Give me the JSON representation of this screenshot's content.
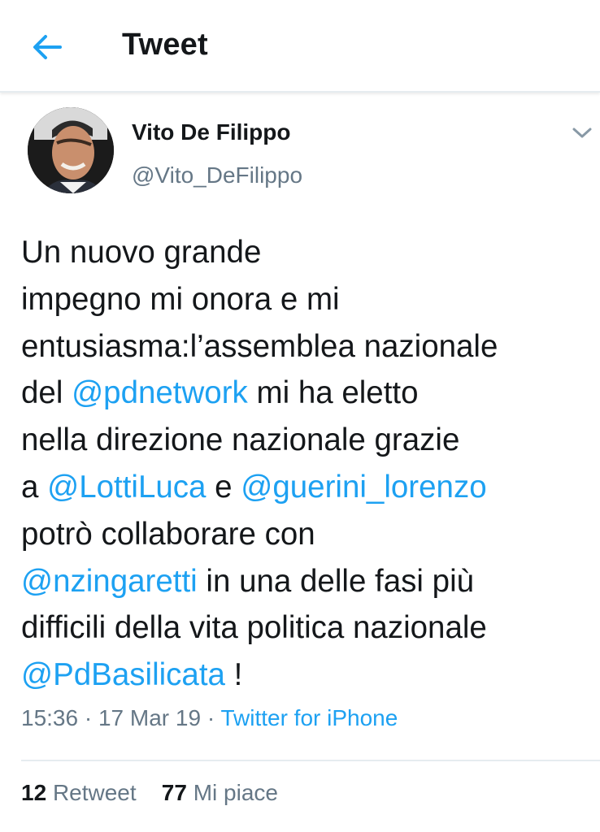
{
  "header": {
    "title": "Tweet"
  },
  "colors": {
    "accent": "#1da1f2",
    "secondary_text": "#657786",
    "primary_text": "#14171a",
    "divider": "#e6ecf0"
  },
  "icons": {
    "back": "arrow-left-icon",
    "menu": "chevron-down-icon"
  },
  "tweet": {
    "author_name": "Vito De Filippo",
    "author_handle": "@Vito_DeFilippo",
    "lines": [
      [
        {
          "t": "Un nuovo grande"
        }
      ],
      [
        {
          "t": "impegno mi onora e mi"
        }
      ],
      [
        {
          "t": "entusiasma:l’assemblea nazionale"
        }
      ],
      [
        {
          "t": "del "
        },
        {
          "t": "@pdnetwork",
          "mention": true
        },
        {
          "t": " mi ha eletto"
        }
      ],
      [
        {
          "t": "nella direzione nazionale grazie"
        }
      ],
      [
        {
          "t": "a "
        },
        {
          "t": "@LottiLuca",
          "mention": true
        },
        {
          "t": " e "
        },
        {
          "t": "@guerini_lorenzo",
          "mention": true
        }
      ],
      [
        {
          "t": "potrò collaborare con"
        }
      ],
      [
        {
          "t": "@nzingaretti",
          "mention": true
        },
        {
          "t": " in una delle fasi più"
        }
      ],
      [
        {
          "t": "difficili della vita politica nazionale"
        }
      ],
      [
        {
          "t": "@PdBasilicata",
          "mention": true
        },
        {
          "t": " !"
        }
      ]
    ],
    "time": "15:36",
    "separator": " · ",
    "date": "17 Mar 19",
    "source": "Twitter for iPhone",
    "retweet_count": "12",
    "retweet_label": "Retweet",
    "like_count": "77",
    "like_label": "Mi piace"
  }
}
